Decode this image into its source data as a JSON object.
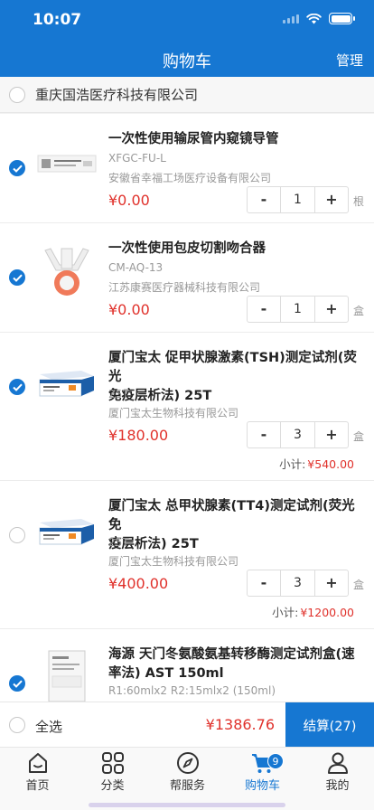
{
  "status_bar": {
    "time": "10:07"
  },
  "header": {
    "title": "购物车",
    "manage_label": "管理"
  },
  "store": {
    "name": "重庆国浩医疗科技有限公司",
    "selected": false
  },
  "items": [
    {
      "name": "一次性使用输尿管内窥镜导管",
      "spec": "XFGC-FU-L",
      "maker": "安徽省幸福工场医疗设备有限公司",
      "price": "¥0.00",
      "qty": "1",
      "unit": "根",
      "selected": true,
      "subtotal_label": "",
      "subtotal": ""
    },
    {
      "name": "一次性使用包皮切割吻合器",
      "spec": "CM-AQ-13",
      "maker": "江苏康赛医疗器械科技有限公司",
      "price": "¥0.00",
      "qty": "1",
      "unit": "盒",
      "selected": true,
      "subtotal_label": "",
      "subtotal": ""
    },
    {
      "name_line1": "厦门宝太 促甲状腺激素(TSH)测定试剂(荧光",
      "name_line2": "免疫层析法) 25T",
      "spec": "25T",
      "maker": "厦门宝太生物科技有限公司",
      "price": "¥180.00",
      "qty": "3",
      "unit": "盒",
      "selected": true,
      "subtotal_label": "小计:",
      "subtotal": "¥540.00"
    },
    {
      "name_line1": "厦门宝太 总甲状腺素(TT4)测定试剂(荧光免",
      "name_line2": "疫层析法) 25T",
      "spec": "25T",
      "maker": "厦门宝太生物科技有限公司",
      "price": "¥400.00",
      "qty": "3",
      "unit": "盒",
      "selected": false,
      "subtotal_label": "小计:",
      "subtotal": "¥1200.00"
    },
    {
      "name_line1": "海源  天门冬氨酸氨基转移酶测定试剂盒(速",
      "name_line2": "率法)  AST  150ml",
      "spec": "R1:60mlx2 R2:15mlx2 (150ml)",
      "selected": true
    }
  ],
  "stepper": {
    "minus": "-",
    "plus": "+"
  },
  "footer": {
    "select_all_label": "全选",
    "total": "¥1386.76",
    "checkout_label": "结算(27)"
  },
  "tabbar": {
    "tabs": [
      {
        "label": "首页",
        "icon": "home-icon"
      },
      {
        "label": "分类",
        "icon": "category-icon"
      },
      {
        "label": "帮服务",
        "icon": "compass-icon"
      },
      {
        "label": "购物车",
        "icon": "cart-icon",
        "active": true,
        "badge": "9"
      },
      {
        "label": "我的",
        "icon": "profile-icon"
      }
    ]
  },
  "colors": {
    "primary": "#1677d2",
    "price": "#e0312b"
  }
}
